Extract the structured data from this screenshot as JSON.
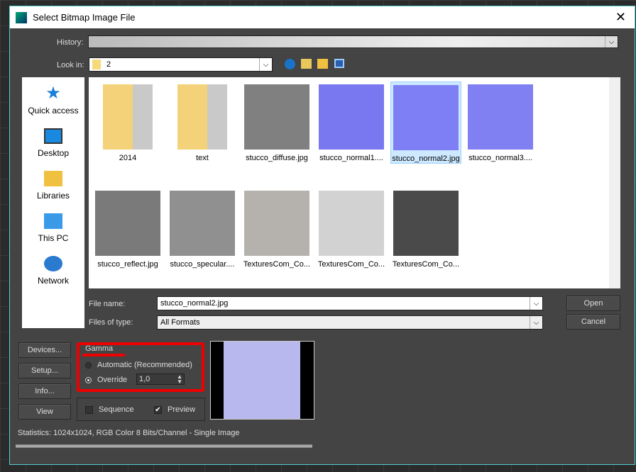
{
  "title": "Select Bitmap Image File",
  "history_label": "History:",
  "lookin_label": "Look in:",
  "lookin_value": "2",
  "places": [
    {
      "label": "Quick access",
      "icon": "star-icon"
    },
    {
      "label": "Desktop",
      "icon": "desktop-icon"
    },
    {
      "label": "Libraries",
      "icon": "libraries-icon"
    },
    {
      "label": "This PC",
      "icon": "pc-icon"
    },
    {
      "label": "Network",
      "icon": "network-icon"
    }
  ],
  "files": [
    {
      "name": "2014",
      "type": "folder"
    },
    {
      "name": "text",
      "type": "folder"
    },
    {
      "name": "stucco_diffuse.jpg",
      "color": "#808080"
    },
    {
      "name": "stucco_normal1....",
      "color": "#7a78f0"
    },
    {
      "name": "stucco_normal2.jpg",
      "color": "#7f7ff5",
      "selected": true
    },
    {
      "name": "stucco_normal3....",
      "color": "#8080f2"
    },
    {
      "name": "stucco_reflect.jpg",
      "color": "#7a7a7a"
    },
    {
      "name": "stucco_specular....",
      "color": "#909090"
    },
    {
      "name": "TexturesCom_Co...",
      "color": "#b5b2ae"
    },
    {
      "name": "TexturesCom_Co...",
      "color": "#d2d2d2"
    },
    {
      "name": "TexturesCom_Co...",
      "color": "#4a4a4a"
    }
  ],
  "filename_label": "File name:",
  "filename_value": "stucco_normal2.jpg",
  "filetype_label": "Files of type:",
  "filetype_value": "All Formats",
  "open": "Open",
  "cancel": "Cancel",
  "devices": "Devices...",
  "setup": "Setup...",
  "info": "Info...",
  "view": "View",
  "gamma": {
    "title": "Gamma",
    "automatic": "Automatic (Recommended)",
    "override": "Override",
    "value": "1,0"
  },
  "sequence": "Sequence",
  "preview": "Preview",
  "statistics": "Statistics:  1024x1024, RGB Color 8 Bits/Channel - Single Image"
}
